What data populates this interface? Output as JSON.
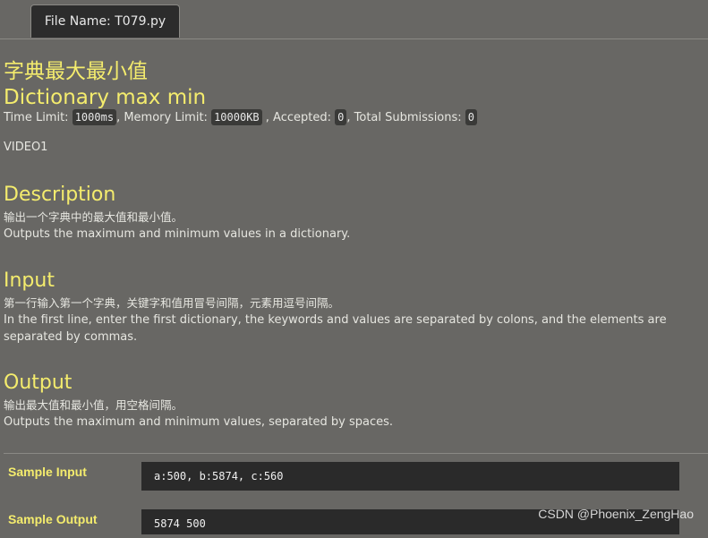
{
  "tab": {
    "file_label": "File Name: T079.py"
  },
  "problem": {
    "title_zh": "字典最大最小值",
    "title_en": "Dictionary max min"
  },
  "limits": {
    "time_label": "Time Limit:",
    "time_value": "1000ms",
    "memory_label": ", Memory Limit:",
    "memory_value": "10000KB",
    "accepted_label": " , Accepted:",
    "accepted_value": "0",
    "submissions_label": ", Total Submissions:",
    "submissions_value": "0"
  },
  "video_label": "VIDEO1",
  "description": {
    "heading": "Description",
    "zh": "输出一个字典中的最大值和最小值。",
    "en": "Outputs the maximum and minimum values in a dictionary."
  },
  "input": {
    "heading": "Input",
    "zh": "第一行输入第一个字典，关键字和值用冒号间隔，元素用逗号间隔。",
    "en": "In the first line, enter the first dictionary, the keywords and values are separated by colons, and the elements are separated by commas."
  },
  "output": {
    "heading": "Output",
    "zh": "输出最大值和最小值，用空格间隔。",
    "en": "Outputs the maximum and minimum values, separated by spaces."
  },
  "samples": {
    "input_label": "Sample Input",
    "input_value": "a:500, b:5874, c:560",
    "output_label": "Sample Output",
    "output_value": "5874 500"
  },
  "watermark": "CSDN @Phoenix_ZengHao",
  "colors": {
    "background": "#686764",
    "heading": "#f4ec6d",
    "code_box": "#2a2a2a"
  }
}
